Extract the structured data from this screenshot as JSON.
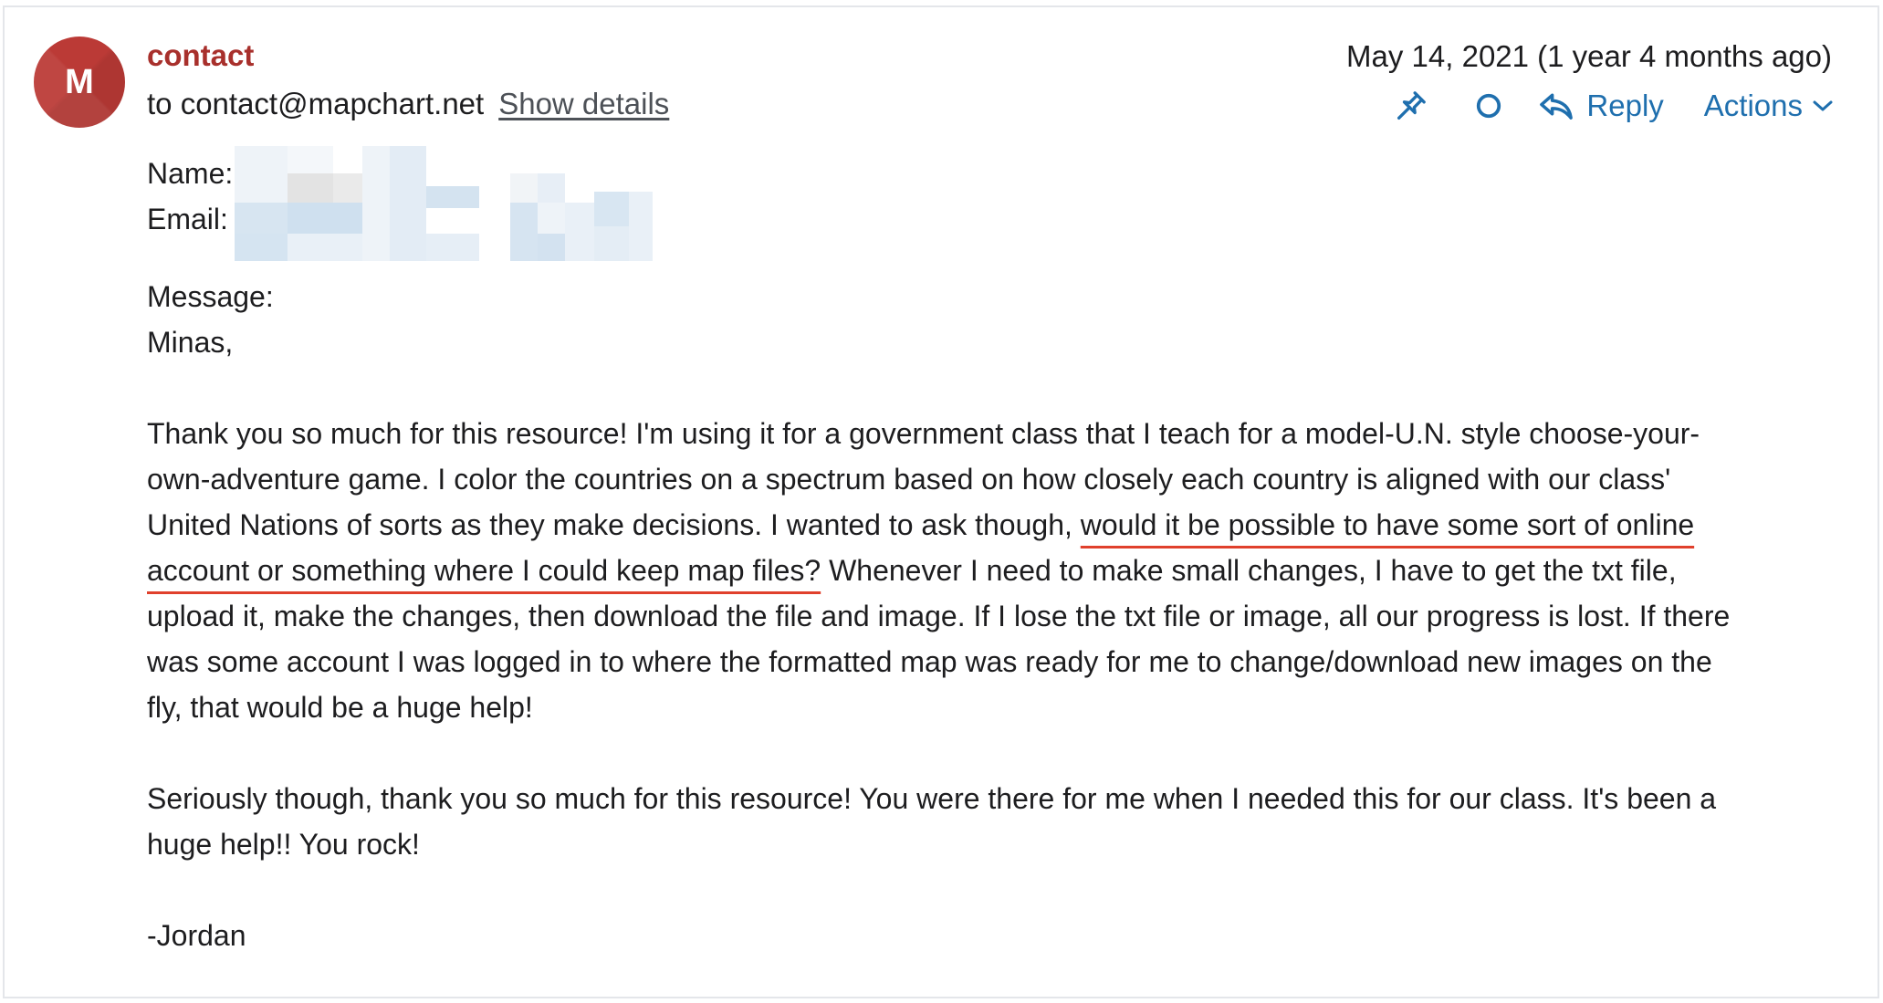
{
  "sender": {
    "avatar_letter": "M",
    "name": "contact",
    "to_prefix": "to ",
    "to_address": "contact@mapchart.net",
    "show_details": "Show details"
  },
  "date": "May 14, 2021 (1 year 4 months ago)",
  "toolbar": {
    "pin_icon": "pin-icon",
    "read_icon": "circle-icon",
    "reply_label": "Reply",
    "actions_label": "Actions"
  },
  "form": {
    "name_label": "Name:",
    "email_label": "Email:",
    "message_label": "Message:"
  },
  "message": {
    "greeting": "Minas,",
    "p1_a": "Thank you so much for this resource! I'm using it for a government class that I teach for a model-U.N. style choose-your-own-adventure game. I color the countries on a spectrum based on how closely each country is aligned with our class' United Nations of sorts as they make decisions. I wanted to ask though, ",
    "p1_highlight": "would it be possible to have some sort of online account or something where I could keep map files?",
    "p1_b": " Whenever I need to make small changes, I have to get the txt file, upload it, make the changes, then download the file and image. If I lose the txt file or image, all our progress is lost. If there was some account I was logged in to where the formatted map was ready for me to change/download new images on the fly, that would be a huge help!",
    "p2": "Seriously though, thank you so much for this resource! You were there for me when I needed this for our class. It's been a huge help!! You rock!",
    "signature": "-Jordan"
  },
  "colors": {
    "avatar": "#bb3a36",
    "sender": "#a8302c",
    "action_blue": "#1f6fae",
    "highlight_underline": "#e0402c"
  }
}
